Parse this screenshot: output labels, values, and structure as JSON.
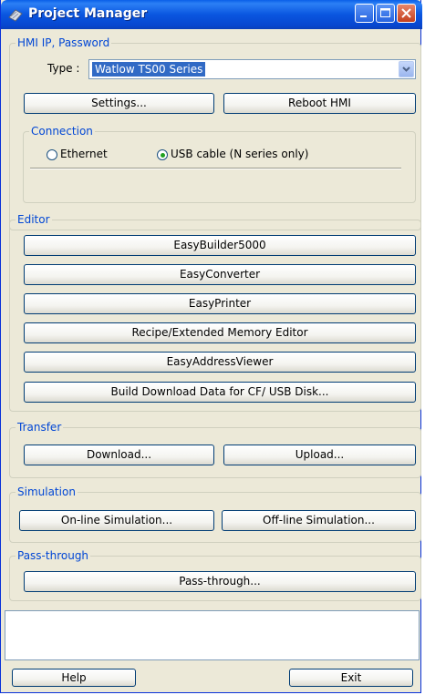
{
  "window": {
    "title": "Project Manager"
  },
  "hmi": {
    "group_label": "HMI IP, Password",
    "type_label": "Type :",
    "type_value": "Watlow TS00 Series",
    "settings_button": "Settings...",
    "reboot_button": "Reboot HMI"
  },
  "connection": {
    "group_label": "Connection",
    "options": [
      {
        "label": "Ethernet",
        "selected": false
      },
      {
        "label": "USB cable (N series only)",
        "selected": true
      }
    ]
  },
  "editor": {
    "group_label": "Editor",
    "buttons": [
      "EasyBuilder5000",
      "EasyConverter",
      "EasyPrinter",
      "Recipe/Extended Memory Editor",
      "EasyAddressViewer",
      "Build Download Data for CF/ USB Disk..."
    ]
  },
  "transfer": {
    "group_label": "Transfer",
    "download_button": "Download...",
    "upload_button": "Upload..."
  },
  "simulation": {
    "group_label": "Simulation",
    "online_button": "On-line Simulation...",
    "offline_button": "Off-line Simulation..."
  },
  "passthrough": {
    "group_label": "Pass-through",
    "button": "Pass-through..."
  },
  "footer": {
    "message_text": "",
    "help_button": "Help",
    "exit_button": "Exit"
  },
  "colors": {
    "titlebar": "#0a56e0",
    "group_label": "#0046d5",
    "close_button": "#c4401e",
    "selection": "#316ac5",
    "radio_dot": "#21a121"
  },
  "icons": {
    "title": "project-manager-icon",
    "minimize": "minimize-icon",
    "maximize": "maximize-icon",
    "close": "close-icon",
    "dropdown": "chevron-down-icon"
  }
}
